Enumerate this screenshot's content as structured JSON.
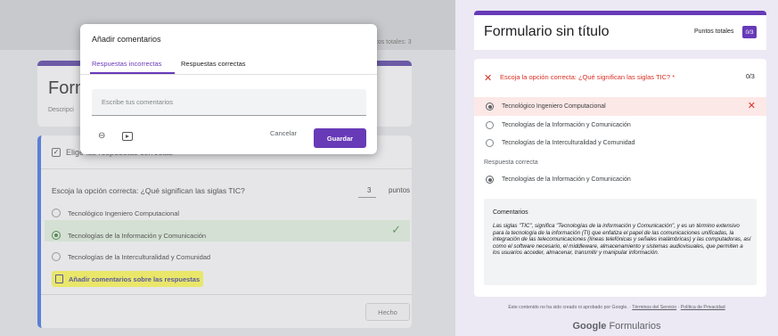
{
  "editor": {
    "points_total_label": "ntos totales: 3",
    "title": "Form",
    "description": "Descripci",
    "question_type_label": "Elige las respuestas correctas",
    "question_text": "Escoja la opción correcta: ¿Qué significan las siglas TIC?",
    "points_value": "3",
    "points_label": "puntos",
    "options": [
      "Tecnológico Ingeniero Computacional",
      "Tecnologías de la Información y Comunicación",
      "Tecnologías de la Interculturalidad y Comunidad"
    ],
    "add_feedback_label": "Añadir comentarios sobre las respuestas",
    "done_label": "Hecho"
  },
  "dialog": {
    "title": "Añadir comentarios",
    "tab_incorrect": "Respuestas incorrectas",
    "tab_correct": "Respuestas correctas",
    "feedback_placeholder": "Escribe tus comentarios",
    "feedback_value": "",
    "cancel_label": "Cancelar",
    "save_label": "Guardar"
  },
  "preview": {
    "form_title": "Formulario sin título",
    "points_total_label": "Puntos totales",
    "points_total_badge": "0/3",
    "question_text": "Escoja la opción correcta: ¿Qué significan las siglas TIC? *",
    "question_score": "0/3",
    "options": [
      "Tecnológico Ingeniero Computacional",
      "Tecnologías de la Información y Comunicación",
      "Tecnologías de la Interculturalidad y Comunidad"
    ],
    "correct_answer_label": "Respuesta correcta",
    "correct_answer": "Tecnologías de la Información y Comunicación",
    "comments_title": "Comentarios",
    "comments_body": "Las siglas \"TIC\", significa \"Tecnologías de la información y Comunicación\", y es un término extensivo para la tecnología de la información (TI) que enfatiza el papel de las comunicaciones unificadas, la integración de las telecomunicaciones (líneas telefónicas y señales inalámbricas) y las computadoras, así como el software necesario, el middleware, almacenamiento y sistemas audiovisuales, que permiten a los usuarios acceder, almacenar, transmitir y manipular información.",
    "footer_text": "Este contenido no ha sido creado ni aprobado por Google. ·",
    "footer_terms": "Términos del Servicio",
    "footer_sep": "·",
    "footer_privacy": "Política de Privacidad",
    "logo_google": "Google",
    "logo_forms": "Formularios"
  },
  "colors": {
    "accent": "#673ab7",
    "error": "#d93025",
    "highlight": "#e9e66a"
  }
}
